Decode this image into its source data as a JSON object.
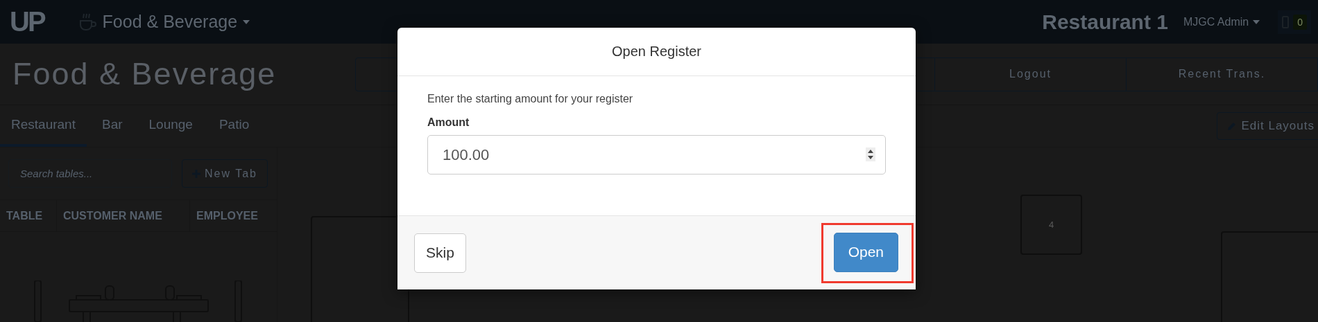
{
  "navbar": {
    "logo": "UP",
    "module": "Food & Beverage",
    "location": "Restaurant 1",
    "user": "MJGC Admin",
    "device_count": "0"
  },
  "page_title": "Food & Beverage",
  "action_buttons": [
    {
      "label": "Logout"
    },
    {
      "label": "Recent Trans."
    }
  ],
  "tabs": [
    {
      "label": "Restaurant",
      "selected": true
    },
    {
      "label": "Bar",
      "selected": false
    },
    {
      "label": "Lounge",
      "selected": false
    },
    {
      "label": "Patio",
      "selected": false
    }
  ],
  "edit_button": "Edit Layouts",
  "search": {
    "placeholder": "Search tables..."
  },
  "new_tab_button": "New Tab",
  "table_columns": [
    "TABLE",
    "CUSTOMER NAME",
    "EMPLOYEE"
  ],
  "floor_tables": [
    {
      "kind": "large"
    },
    {
      "kind": "small",
      "label": "4"
    },
    {
      "kind": "large"
    }
  ],
  "modal": {
    "title": "Open Register",
    "message": "Enter the starting amount for your register",
    "field_label": "Amount",
    "amount": "100.00",
    "buttons": [
      {
        "label": "Skip",
        "kind": "default",
        "highlighted": false
      },
      {
        "label": "Open",
        "kind": "primary",
        "highlighted": true
      }
    ]
  }
}
